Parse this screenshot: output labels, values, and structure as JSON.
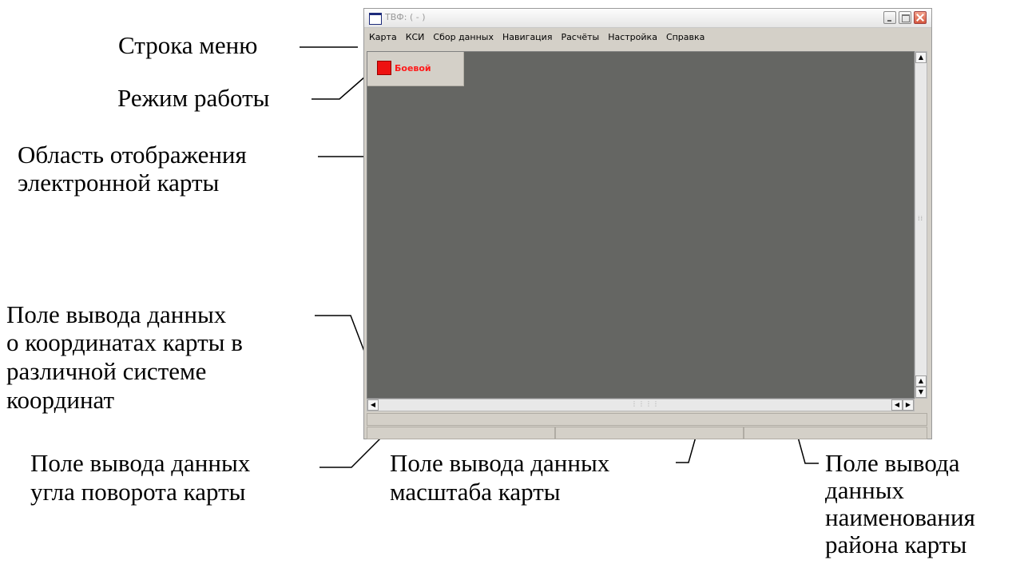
{
  "window": {
    "title": "ТВФ: ( - )",
    "menu": [
      "Карта",
      "КСИ",
      "Сбор данных",
      "Навигация",
      "Расчёты",
      "Настройка",
      "Справка"
    ],
    "mode": {
      "label": "Боевой",
      "color": "#ee1111"
    },
    "status_bar": {
      "coordinates": "",
      "rotation_angle": "",
      "scale": "",
      "area_name": ""
    }
  },
  "annotations": {
    "menu_bar": "Строка меню",
    "mode": "Режим работы",
    "map_area": [
      "Область отображения",
      "электронной карты"
    ],
    "coordinates": [
      "Поле вывода данных",
      "о координатах карты в",
      "различной системе",
      "координат"
    ],
    "rotation": [
      "Поле вывода данных",
      "угла поворота карты"
    ],
    "scale": [
      "Поле вывода данных",
      "масштаба карты"
    ],
    "area_name": [
      "Поле вывода",
      "данных",
      "наименования",
      "района  карты"
    ]
  },
  "colors": {
    "map_background": "#656663",
    "window_background": "#d4d0c8",
    "mode_text": "#ff1a1a"
  }
}
